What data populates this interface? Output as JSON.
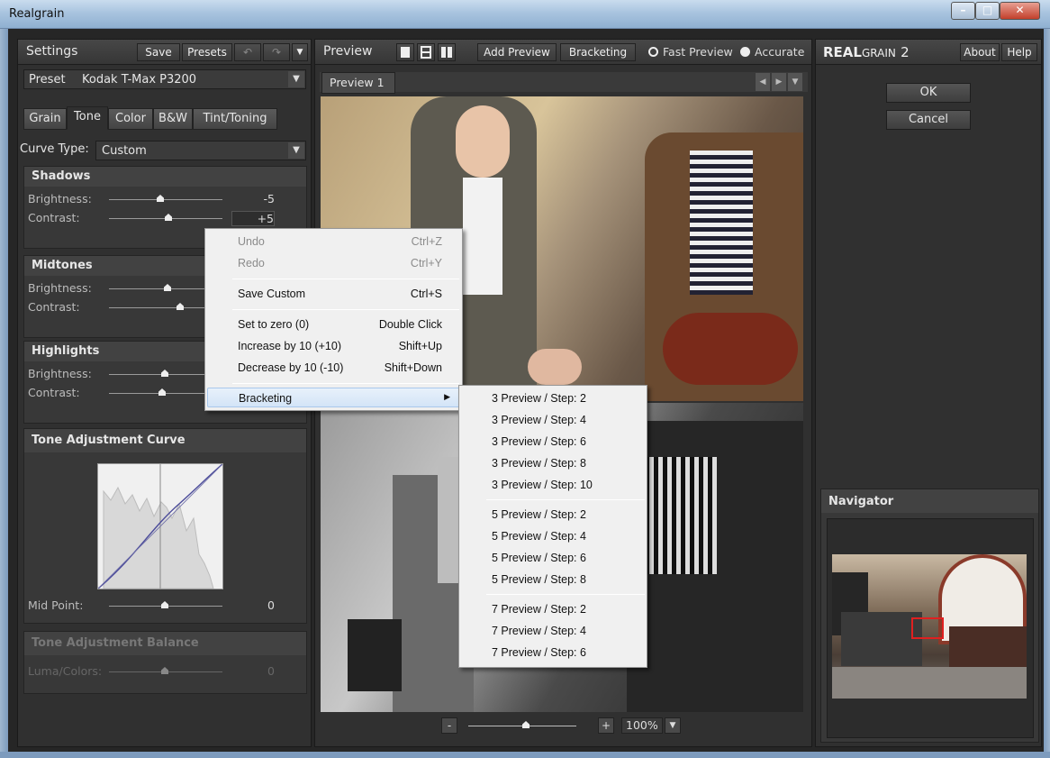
{
  "window": {
    "title": "Realgrain"
  },
  "settings": {
    "title": "Settings",
    "save": "Save",
    "presets": "Presets",
    "preset_label": "Preset",
    "preset_value": "Kodak T-Max P3200",
    "tabs": [
      "Grain",
      "Tone",
      "Color",
      "B&W",
      "Tint/Toning"
    ],
    "active_tab": "Tone",
    "curve_type_label": "Curve Type:",
    "curve_type_value": "Custom",
    "shadows": {
      "title": "Shadows",
      "brightness_label": "Brightness:",
      "brightness": "-5",
      "contrast_label": "Contrast:",
      "contrast": "+5"
    },
    "midtones": {
      "title": "Midtones",
      "brightness_label": "Brightness:",
      "contrast_label": "Contrast:"
    },
    "highlights": {
      "title": "Highlights",
      "brightness_label": "Brightness:",
      "contrast_label": "Contrast:"
    },
    "curve": {
      "title": "Tone Adjustment Curve",
      "midpoint_label": "Mid Point:",
      "midpoint": "0"
    },
    "balance": {
      "title": "Tone Adjustment Balance",
      "luma_label": "Luma/Colors:",
      "luma": "0"
    }
  },
  "preview": {
    "title": "Preview",
    "add_preview": "Add Preview",
    "bracketing": "Bracketing",
    "fast_preview": "Fast Preview",
    "accurate": "Accurate",
    "tab": "Preview 1",
    "zoom": "100%",
    "zoom_minus": "-",
    "zoom_plus": "+"
  },
  "right": {
    "brand_big": "REAL",
    "brand_small": "GRAIN",
    "brand_num": "2",
    "about": "About",
    "help": "Help",
    "ok": "OK",
    "cancel": "Cancel",
    "navigator": "Navigator"
  },
  "context_menu": {
    "items": [
      {
        "label": "Undo",
        "shortcut": "Ctrl+Z"
      },
      {
        "label": "Redo",
        "shortcut": "Ctrl+Y"
      },
      {
        "label": "Save Custom",
        "shortcut": "Ctrl+S"
      },
      {
        "label": "Set to zero (0)",
        "shortcut": "Double Click"
      },
      {
        "label": "Increase by 10 (+10)",
        "shortcut": "Shift+Up"
      },
      {
        "label": "Decrease by 10 (-10)",
        "shortcut": "Shift+Down"
      },
      {
        "label": "Bracketing",
        "shortcut": ""
      }
    ]
  },
  "submenu": {
    "items": [
      "3 Preview / Step: 2",
      "3 Preview / Step: 4",
      "3 Preview / Step: 6",
      "3 Preview / Step: 8",
      "3 Preview / Step: 10",
      "5 Preview / Step: 2",
      "5 Preview / Step: 4",
      "5 Preview / Step: 6",
      "5 Preview / Step: 8",
      "7 Preview / Step: 2",
      "7 Preview / Step: 4",
      "7 Preview / Step: 6"
    ]
  }
}
